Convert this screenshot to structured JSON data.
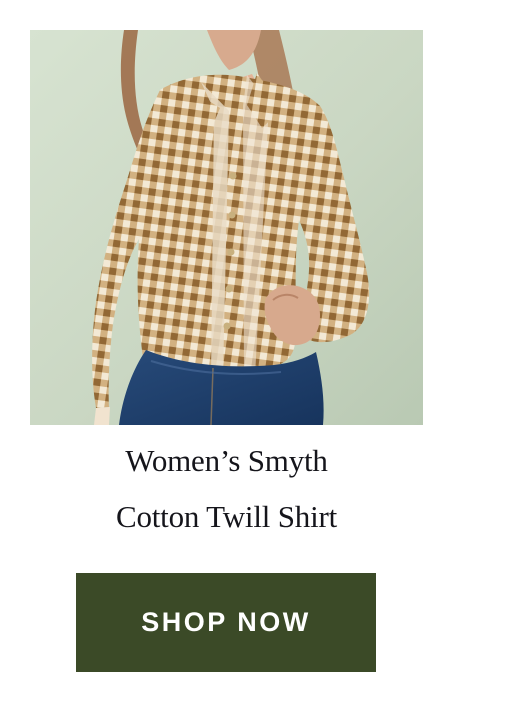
{
  "product": {
    "title_line_1": "Women’s Smyth",
    "title_line_2": "Cotton Twill Shirt",
    "image_alt": "Model wearing a brown and cream gingham button-up shirt with blue jeans"
  },
  "cta": {
    "label": "SHOP NOW",
    "background_color": "#3b4a27",
    "text_color": "#ffffff"
  },
  "colors": {
    "background": "#ffffff",
    "image_backdrop": "#cbd8c5",
    "shirt_check": "#9a6b2f",
    "denim": "#1f3c67"
  }
}
